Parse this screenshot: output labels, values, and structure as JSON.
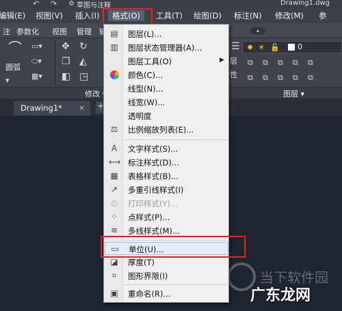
{
  "titlebar": {
    "workspace": "草图与注释",
    "document_title": "Drawing1.dwg"
  },
  "menubar": {
    "items": [
      {
        "label": "编辑(E)"
      },
      {
        "label": "视图(V)"
      },
      {
        "label": "插入(I)"
      },
      {
        "label": "格式(O)"
      },
      {
        "label": "工具(T)"
      },
      {
        "label": "绘图(D)"
      },
      {
        "label": "标注(N)"
      },
      {
        "label": "修改(M)"
      },
      {
        "label": "参"
      }
    ],
    "active": "格式(O)"
  },
  "ribbon_tabs": {
    "items": [
      {
        "label": "注"
      },
      {
        "label": "参数化"
      },
      {
        "label": "视图"
      },
      {
        "label": "管理"
      },
      {
        "label": "输"
      }
    ]
  },
  "ribbon": {
    "arc_label": "圆弧",
    "modify_label": "修改 ▾",
    "layer_label": "图层 ▾",
    "layer_value": "0",
    "layer_side_1": "层",
    "layer_side_2": "性"
  },
  "doc_tabs": {
    "active_tab": "Drawing1*",
    "close": "×",
    "new_tab": "+"
  },
  "format_menu": {
    "items": [
      {
        "label": "图层(L)...",
        "icon": "layer-icon"
      },
      {
        "label": "图层状态管理器(A)...",
        "icon": "layer-state-icon"
      },
      {
        "label": "图层工具(O)",
        "icon": "",
        "submenu": true
      },
      {
        "label": "颜色(C)...",
        "icon": "color-wheel-icon"
      },
      {
        "label": "线型(N)...",
        "icon": ""
      },
      {
        "label": "线宽(W)...",
        "icon": ""
      },
      {
        "label": "透明度",
        "icon": ""
      },
      {
        "label": "比例缩放列表(E)...",
        "icon": "scale-list-icon"
      },
      {
        "label": "文字样式(S)...",
        "icon": "text-style-icon"
      },
      {
        "label": "标注样式(D)...",
        "icon": "dim-style-icon"
      },
      {
        "label": "表格样式(B)...",
        "icon": "table-style-icon"
      },
      {
        "label": "多重引线样式(I)",
        "icon": "mleader-style-icon"
      },
      {
        "label": "打印样式(Y)...",
        "icon": "plot-style-icon",
        "disabled": true
      },
      {
        "label": "点样式(P)...",
        "icon": "point-style-icon"
      },
      {
        "label": "多线样式(M)...",
        "icon": "mline-style-icon"
      },
      {
        "label": "单位(U)...",
        "icon": "units-icon",
        "highlighted": true
      },
      {
        "label": "厚度(T)",
        "icon": "thickness-icon"
      },
      {
        "label": "图形界限(I)",
        "icon": "drawing-limits-icon"
      },
      {
        "label": "重命名(R)...",
        "icon": "rename-icon"
      }
    ]
  },
  "watermark": {
    "line1": "当下软件园",
    "line2": "广东龙网"
  },
  "colors": {
    "highlight_red": "#e0202a",
    "menu_bg": "#f0f0f0",
    "canvas_bg": "#1f2530"
  }
}
